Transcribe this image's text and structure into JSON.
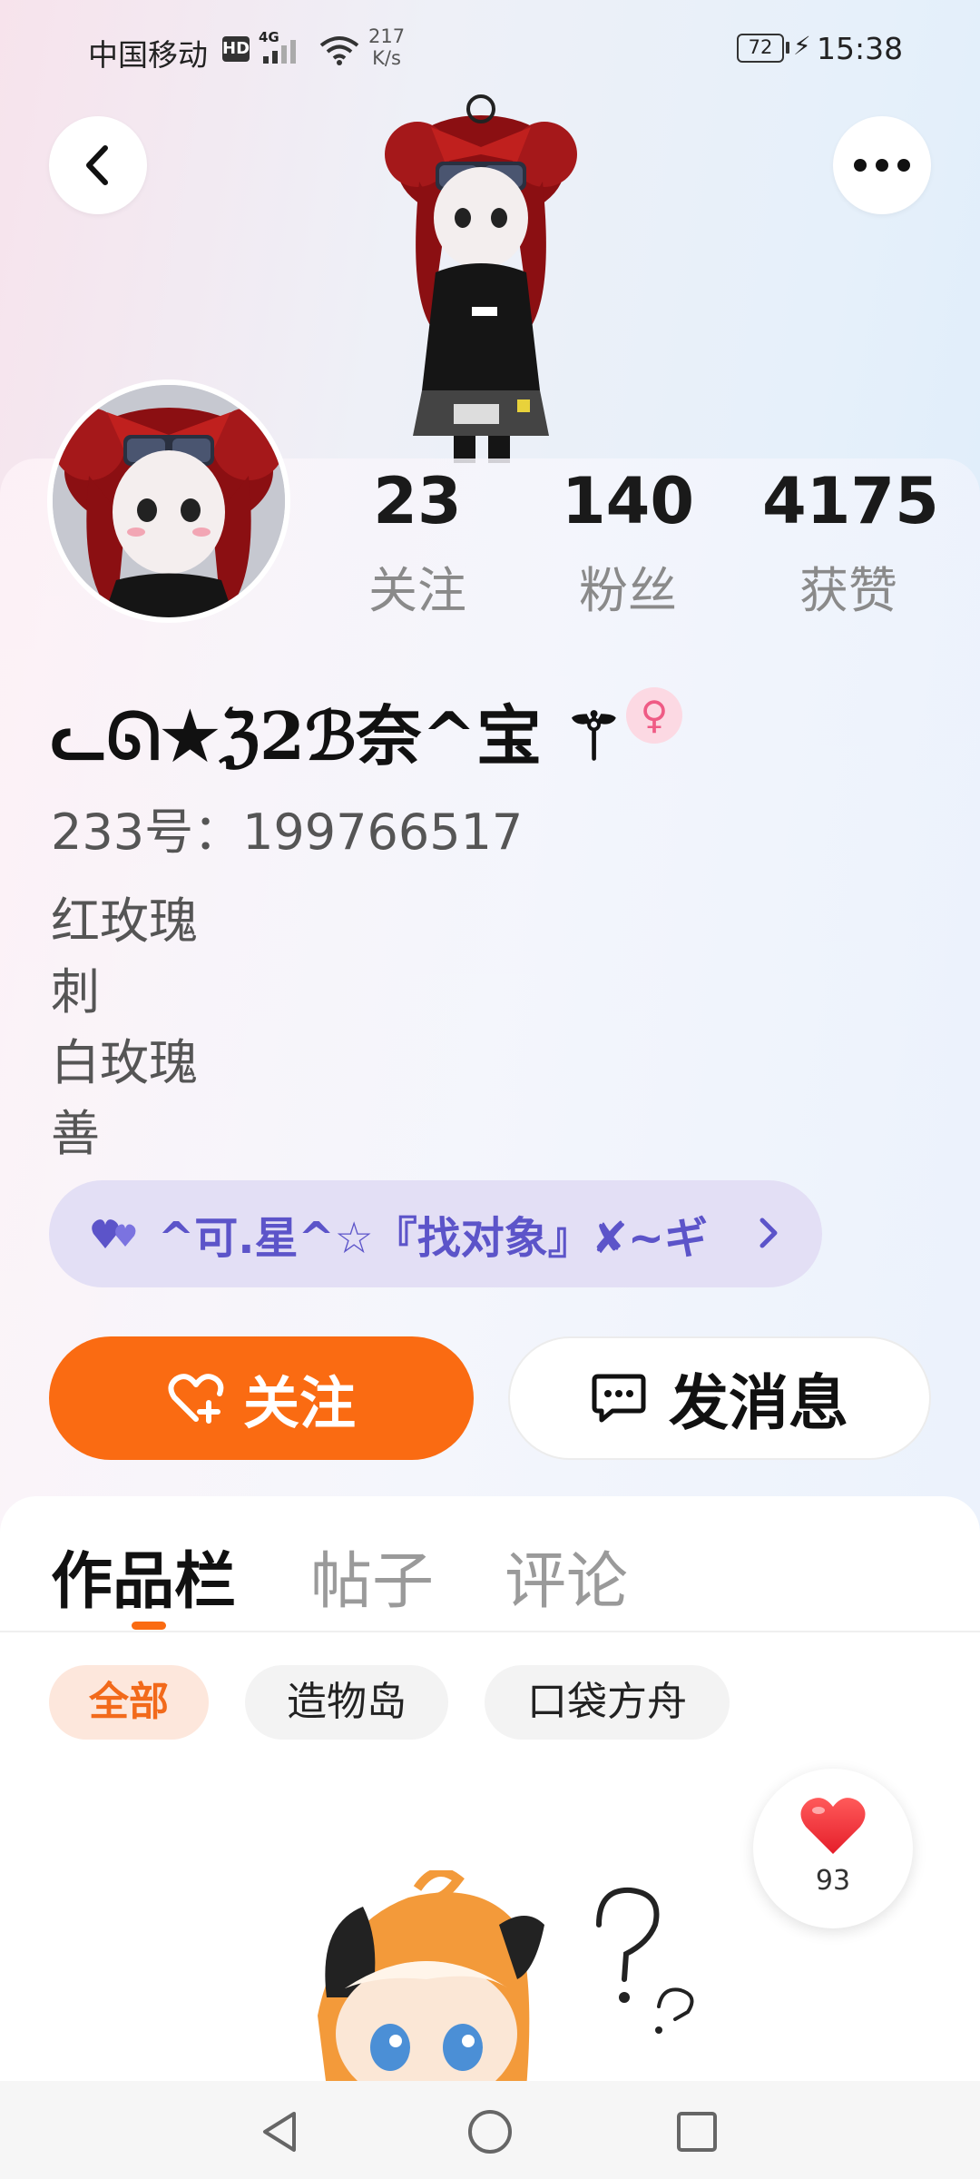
{
  "status_bar": {
    "carrier": "中国移动",
    "hd": "HD",
    "network": "4G",
    "speed_value": "217",
    "speed_unit": "K/s",
    "battery": "72",
    "time": "15:38"
  },
  "header": {
    "back_icon": "chevron-left-icon",
    "more_icon": "more-dots-icon"
  },
  "stats": [
    {
      "value": "23",
      "label": "关注"
    },
    {
      "value": "140",
      "label": "粉丝"
    },
    {
      "value": "4175",
      "label": "获赞"
    }
  ],
  "profile": {
    "username": "ᓚᘏ★ℨ2ℬ奈^宝 ⚚",
    "gender_symbol": "♀",
    "uid": "233号：199766517",
    "bio_lines": [
      "红玫瑰",
      "刺",
      "白玫瑰",
      "善"
    ]
  },
  "group": {
    "name": "^可.星^☆『找对象』✘~ギ",
    "icon": "hearts-icon"
  },
  "actions": {
    "follow_label": "关注",
    "message_label": "发消息"
  },
  "tabs": [
    {
      "label": "作品栏",
      "active": true
    },
    {
      "label": "帖子",
      "active": false
    },
    {
      "label": "评论",
      "active": false
    }
  ],
  "filters": [
    {
      "label": "全部",
      "active": true
    },
    {
      "label": "造物岛",
      "active": false
    },
    {
      "label": "口袋方舟",
      "active": false
    }
  ],
  "like_float": {
    "count": "93"
  },
  "colors": {
    "accent": "#fa6b12",
    "group_text": "#5c54c9",
    "group_bg": "#e3dff5"
  }
}
